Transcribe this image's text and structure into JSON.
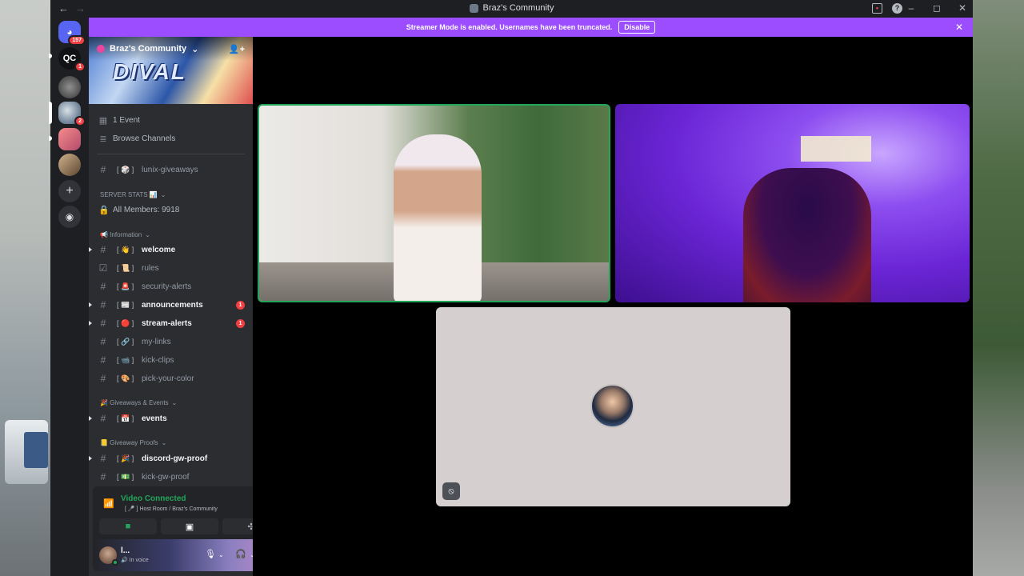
{
  "window": {
    "title": "Braz's Community",
    "nav_back": "←",
    "nav_forward": "→",
    "inbox_icon": "inbox-icon",
    "help_icon": "?",
    "minimize": "–",
    "maximize": "◻",
    "close": "✕"
  },
  "servers": [
    {
      "name": "discord-home",
      "badge": "157"
    },
    {
      "name": "qc",
      "label": "QC",
      "badge": "1"
    },
    {
      "name": "server-3"
    },
    {
      "name": "server-4",
      "badge": "2"
    },
    {
      "name": "server-5"
    },
    {
      "name": "server-6"
    }
  ],
  "server_actions": {
    "add": "+",
    "discover": "◉"
  },
  "banner": {
    "text": "Streamer Mode is enabled. Usernames have been truncated.",
    "button": "Disable",
    "close": "✕"
  },
  "guild": {
    "name": "Braz's Community",
    "chevron": "⌄",
    "banner_text": "DIVAL"
  },
  "top_items": [
    {
      "icon": "calendar-icon",
      "label": "1 Event"
    },
    {
      "icon": "browse-channels-icon",
      "label": "Browse Channels"
    }
  ],
  "channels_top": [
    {
      "emoji": "[ 🎲 ]",
      "name": "lunix-giveaways",
      "unread": false
    }
  ],
  "server_stats": {
    "category": "SERVER STATS 📊",
    "members": "All Members: 9918"
  },
  "categories": [
    {
      "title": "📢 Information",
      "channels": [
        {
          "emoji": "[ 👋 ]",
          "name": "welcome",
          "unread": true,
          "mention": ""
        },
        {
          "emoji": "[ 📜 ]",
          "name": "rules",
          "unread": false,
          "mention": ""
        },
        {
          "emoji": "[ 🚨 ]",
          "name": "security-alerts",
          "unread": false,
          "mention": ""
        },
        {
          "emoji": "[ 📰 ]",
          "name": "announcements",
          "unread": true,
          "mention": "1"
        },
        {
          "emoji": "[ 🔴 ]",
          "name": "stream-alerts",
          "unread": true,
          "mention": "1"
        },
        {
          "emoji": "[ 🔗 ]",
          "name": "my-links",
          "unread": false,
          "mention": ""
        },
        {
          "emoji": "[ 📹 ]",
          "name": "kick-clips",
          "unread": false,
          "mention": ""
        },
        {
          "emoji": "[ 🎨 ]",
          "name": "pick-your-color",
          "unread": false,
          "mention": ""
        }
      ]
    },
    {
      "title": "🎉 Giveaways & Events",
      "channels": [
        {
          "emoji": "[ 📅 ]",
          "name": "events",
          "unread": true,
          "mention": ""
        }
      ]
    },
    {
      "title": "📒 Giveaway Proofs",
      "channels": [
        {
          "emoji": "[ 🎉 ]",
          "name": "discord-gw-proof",
          "unread": true,
          "mention": ""
        },
        {
          "emoji": "[ 💵 ]",
          "name": "kick-gw-proof",
          "unread": false,
          "mention": ""
        }
      ]
    }
  ],
  "voice_panel": {
    "status": "Video Connected",
    "location": "[ 🎤 ] Host Room / Braz's Community"
  },
  "user_panel": {
    "username": "l...",
    "status": "🔊 In voice"
  },
  "colors": {
    "accent_purple": "#9b4dff",
    "connected_green": "#23a55a",
    "mention_red": "#f23f42"
  }
}
